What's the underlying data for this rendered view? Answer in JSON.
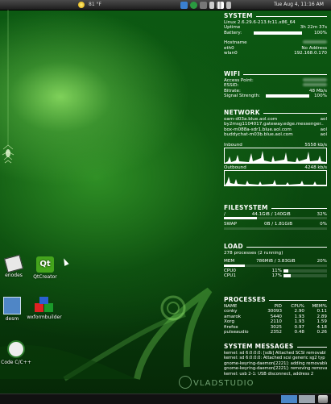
{
  "topbar": {
    "weather_icon": "sun-icon",
    "temperature": "81 °F",
    "clock": "Tue Aug  4, 11:16 AM"
  },
  "system": {
    "title": "SYSTEM",
    "kernel": "Linux 2.6.29.6-213.fc11.x86_64",
    "uptime_label": "Uptime",
    "uptime": "3h 22m 37s",
    "battery_label": "Battery:",
    "battery_value": "100%",
    "battery_fill": 1.0,
    "hostname_label": "Hostname",
    "eth0_label": "eth0",
    "eth0_value": "No Address",
    "wlan0_label": "wlan0",
    "wlan0_value": "192.168.0.170"
  },
  "wifi": {
    "title": "WIFI",
    "ap_label": "Access Point:",
    "essid_label": "ESSID:",
    "bitrate_label": "Bitrate:",
    "bitrate_value": "48 Mb/s",
    "signal_label": "Signal Strength:",
    "signal_value": "100%",
    "signal_fill": 1.0
  },
  "network": {
    "title": "NETWORK",
    "connections": [
      {
        "host": "oam-d03a.blue.aol.com",
        "proto": "aol"
      },
      {
        "host": "by2msg1104017.gateway.edge.messenger..",
        "proto": ""
      },
      {
        "host": "box-m088a-sdr1.blue.aol.com",
        "proto": "aol"
      },
      {
        "host": "buddychat-m03b.blue.aol.com",
        "proto": "aol"
      }
    ],
    "inbound_label": "Inbound",
    "inbound_value": "5558  kb/s",
    "outbound_label": "Outbound",
    "outbound_value": "4248  kb/s"
  },
  "filesystem": {
    "title": "FILESYSTEM",
    "root_label": "/",
    "root_usage": "44.1GiB / 140GiB",
    "root_pct": "32%",
    "root_fill": 0.32,
    "swap_label": "SWAP",
    "swap_usage": "0B  / 1.81GiB",
    "swap_pct": "0%",
    "swap_fill": 0.0
  },
  "load": {
    "title": "LOAD",
    "processes": "278 processes (2 running)",
    "mem_label": "MEM",
    "mem_usage": "786MiB / 3.83GiB",
    "mem_pct": "20%",
    "mem_fill": 0.2,
    "cpu0_label": "CPU0",
    "cpu0_pct": "11%",
    "cpu0_fill": 0.11,
    "cpu1_label": "CPU1",
    "cpu1_pct": "17%",
    "cpu1_fill": 0.17
  },
  "processes": {
    "title": "PROCESSES",
    "headers": [
      "NAME",
      "PID",
      "CPU%",
      "MEM%"
    ],
    "rows": [
      [
        "conky",
        "30093",
        "2.90",
        "0.11"
      ],
      [
        "amarok",
        "5440",
        "1.93",
        "2.89"
      ],
      [
        "Xorg",
        "2110",
        "1.93",
        "1.59"
      ],
      [
        "firefox",
        "3025",
        "0.97",
        "4.18"
      ],
      [
        "pulseaudio",
        "2352",
        "0.48",
        "0.26"
      ]
    ]
  },
  "messages": {
    "title": "SYSTEM MESSAGES",
    "lines": [
      "kernel: sd 6:0:0:0: [sdb] Attached SCSI removabl",
      "kernel: sd 6:0:0:0: Attached scsi generic sg2 typ",
      "gnome-keyring-daemon[2221]: adding removable",
      "gnome-keyring-daemon[2221]: removing removab",
      "kernel: usb 2-1: USB disconnect, address 2"
    ]
  },
  "desktop": {
    "icons": [
      {
        "label": "enodes"
      },
      {
        "label": "QtCreator"
      },
      {
        "label": "desm"
      },
      {
        "label": "wxformbuilder"
      },
      {
        "label": "Code C/C++"
      }
    ]
  },
  "watermark": "VLADSTUDIO"
}
